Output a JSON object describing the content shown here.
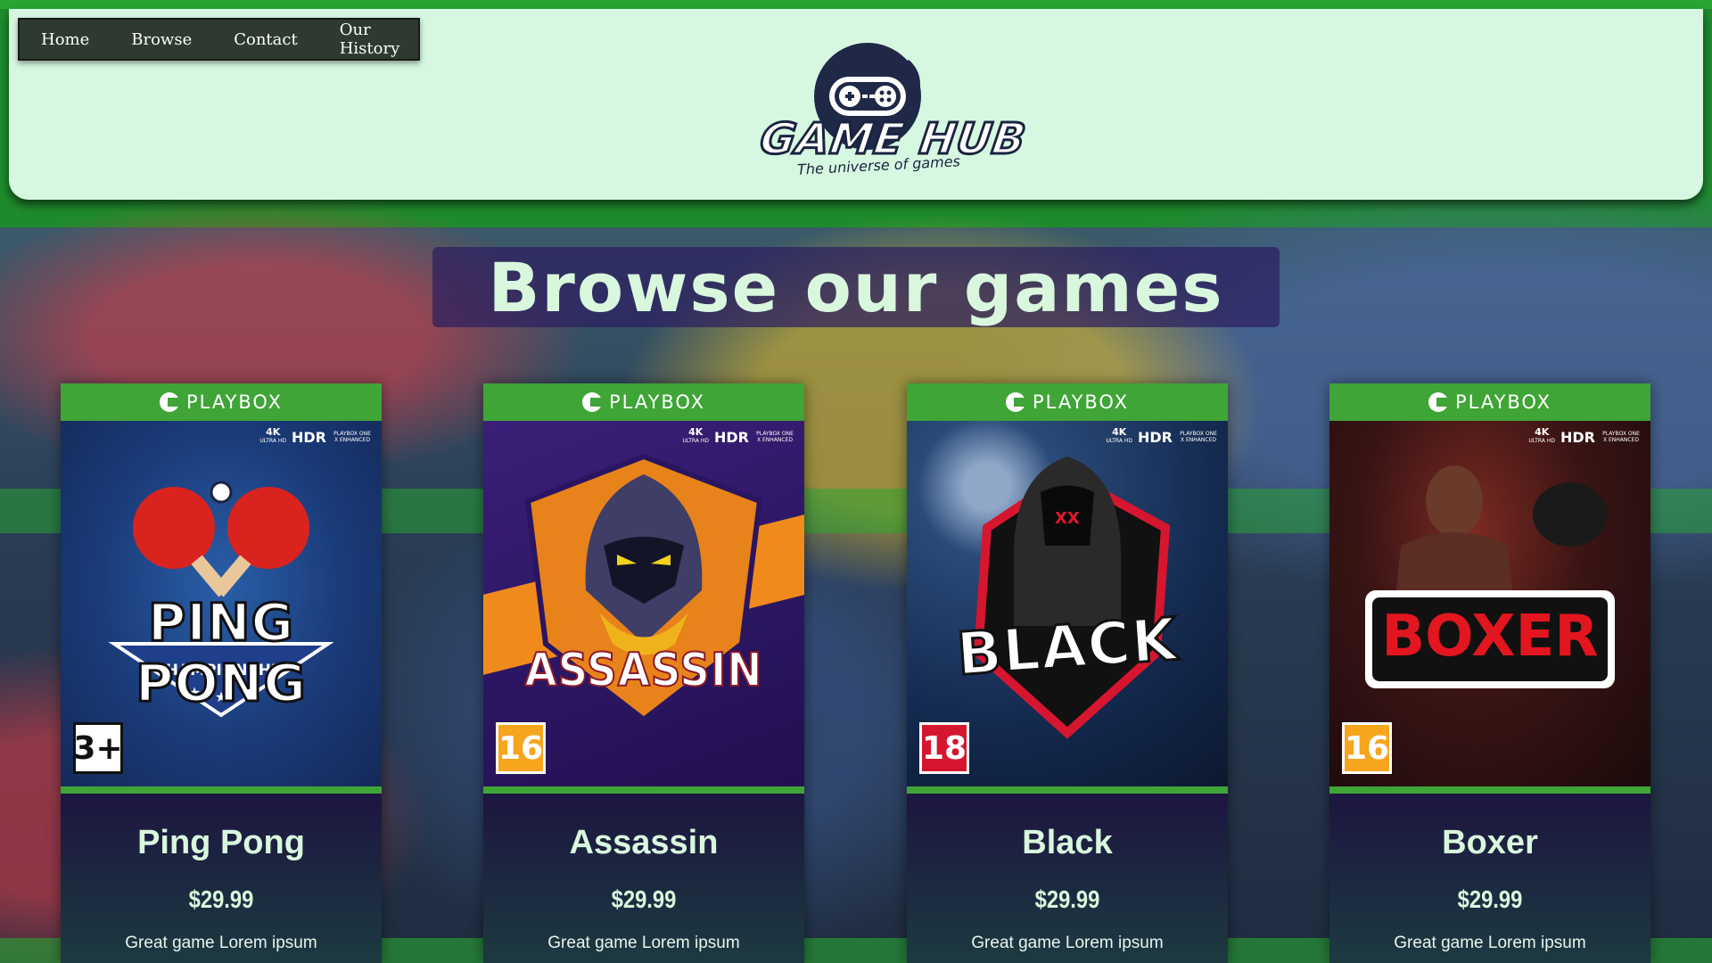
{
  "nav": {
    "items": [
      {
        "label": "Home"
      },
      {
        "label": "Browse"
      },
      {
        "label": "Contact"
      },
      {
        "label": "Our History"
      }
    ]
  },
  "logo": {
    "wordmark": "GAME HUB",
    "tagline": "The universe of games"
  },
  "page_title": "Browse our games",
  "colors": {
    "header_bg": "#d6f8e1",
    "nav_bg": "#2e3a2f",
    "brand_green": "#3fa536",
    "card_bg": "#231448",
    "title_text": "#d8f7dd"
  },
  "cards": [
    {
      "brand": "PLAYBOX",
      "hdr": {
        "k4": "4K",
        "k4_sub": "ULTRA HD",
        "hdr": "HDR",
        "enhanced": "PLAYBOX ONE X ENHANCED"
      },
      "art_title": "PING PONG",
      "art_subtitle": "CHAMPIONSHIP",
      "age_rating": "3+",
      "name": "Ping Pong",
      "price": "$29.99",
      "description": "Great game Lorem ipsum"
    },
    {
      "brand": "PLAYBOX",
      "hdr": {
        "k4": "4K",
        "k4_sub": "ULTRA HD",
        "hdr": "HDR",
        "enhanced": "PLAYBOX ONE X ENHANCED"
      },
      "art_title": "ASSASSIN",
      "art_subtitle": "",
      "age_rating": "16",
      "name": "Assassin",
      "price": "$29.99",
      "description": "Great game Lorem ipsum"
    },
    {
      "brand": "PLAYBOX",
      "hdr": {
        "k4": "4K",
        "k4_sub": "ULTRA HD",
        "hdr": "HDR",
        "enhanced": "PLAYBOX ONE X ENHANCED"
      },
      "art_title": "BLACK",
      "art_subtitle": "",
      "age_rating": "18",
      "name": "Black",
      "price": "$29.99",
      "description": "Great game Lorem ipsum"
    },
    {
      "brand": "PLAYBOX",
      "hdr": {
        "k4": "4K",
        "k4_sub": "ULTRA HD",
        "hdr": "HDR",
        "enhanced": "PLAYBOX ONE X ENHANCED"
      },
      "art_title": "BOXER",
      "art_subtitle": "",
      "age_rating": "16",
      "name": "Boxer",
      "price": "$29.99",
      "description": "Great game Lorem ipsum"
    }
  ]
}
